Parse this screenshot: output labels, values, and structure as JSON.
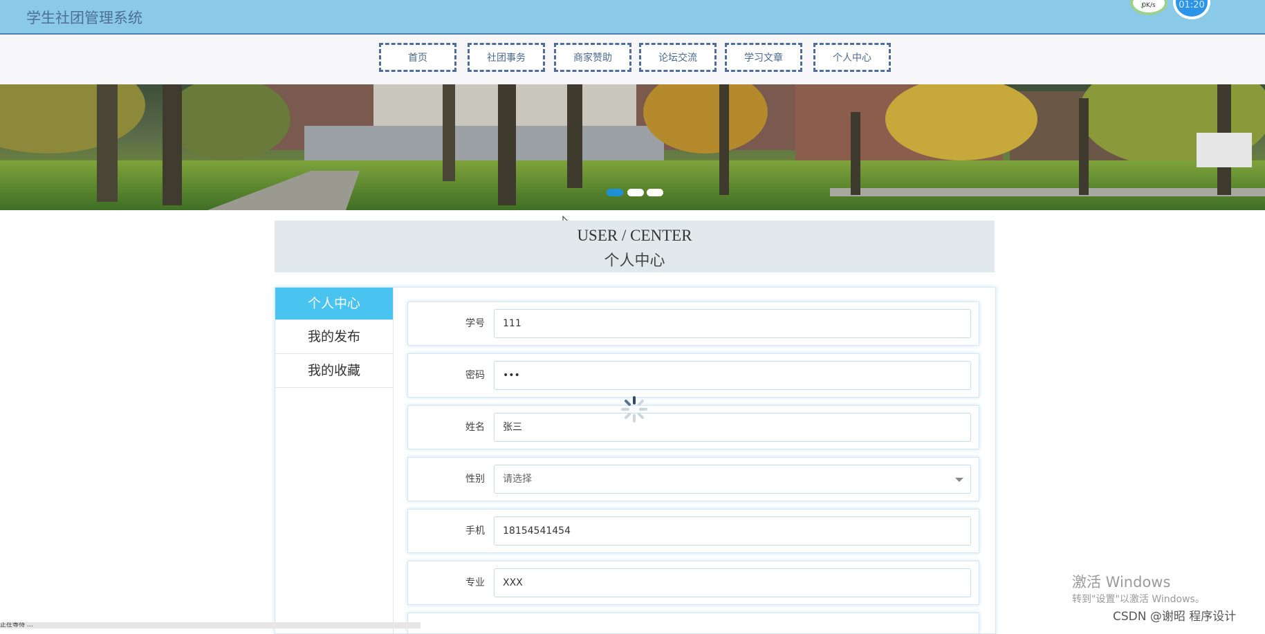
{
  "header": {
    "title": "学生社团管理系统",
    "net_speed": "0K/s",
    "time": "01:20"
  },
  "nav": {
    "items": [
      {
        "label": "首页"
      },
      {
        "label": "社团事务"
      },
      {
        "label": "商家赞助"
      },
      {
        "label": "论坛交流"
      },
      {
        "label": "学习文章"
      },
      {
        "label": "个人中心"
      }
    ]
  },
  "banner": {
    "active_dot": 0,
    "dot_count": 3,
    "colors": {
      "active": "#1e90d6",
      "inactive": "#ffffff"
    }
  },
  "section": {
    "title_en": "USER / CENTER",
    "title_zh": "个人中心"
  },
  "sidebar": {
    "items": [
      {
        "label": "个人中心",
        "active": true
      },
      {
        "label": "我的发布",
        "active": false
      },
      {
        "label": "我的收藏",
        "active": false
      }
    ]
  },
  "form": {
    "fields": [
      {
        "label": "学号",
        "value": "111"
      },
      {
        "label": "密码",
        "value": "•••"
      },
      {
        "label": "姓名",
        "value": "张三"
      },
      {
        "label": "性别",
        "value": "请选择"
      },
      {
        "label": "手机",
        "value": "18154541454"
      },
      {
        "label": "专业",
        "value": "XXX"
      }
    ]
  },
  "status_bar": {
    "text": "正在等待 …"
  },
  "overlay": {
    "windows_activate_title": "激活 Windows",
    "windows_activate_sub": "转到\"设置\"以激活 Windows。",
    "csdn_watermark": "CSDN @谢昭  程序设计"
  },
  "colors": {
    "header_bg": "#8ac9e8",
    "accent": "#49c3f0",
    "nav_border": "#4e6d9d"
  }
}
